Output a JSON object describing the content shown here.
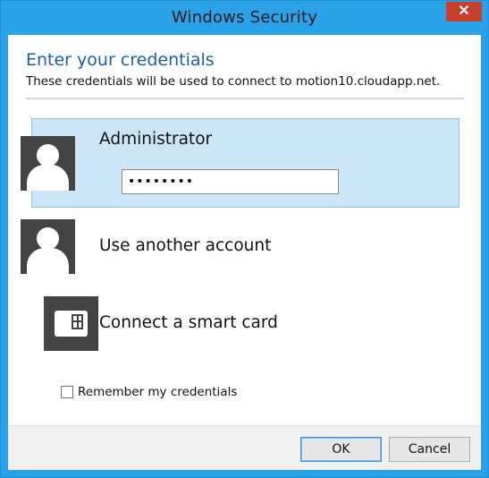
{
  "window": {
    "title": "Windows Security",
    "close_glyph": "✕"
  },
  "header": {
    "title": "Enter your credentials",
    "subtitle": "These credentials will be used to connect to motion10.cloudapp.net."
  },
  "accounts": [
    {
      "name": "Administrator",
      "icon": "user-avatar-icon",
      "selected": true,
      "password_value": "••••••••"
    },
    {
      "name": "Use another account",
      "icon": "user-avatar-icon",
      "selected": false
    },
    {
      "name": "Connect a smart card",
      "icon": "smart-card-icon",
      "selected": false
    }
  ],
  "remember": {
    "label": "Remember my credentials",
    "checked": false
  },
  "buttons": {
    "ok": "OK",
    "cancel": "Cancel"
  },
  "colors": {
    "window_border": "#2aa1e8",
    "close_button": "#c7402b",
    "selected_tile": "#cde6f7",
    "header_title": "#1a5fa8",
    "icon_tile": "#444444"
  }
}
